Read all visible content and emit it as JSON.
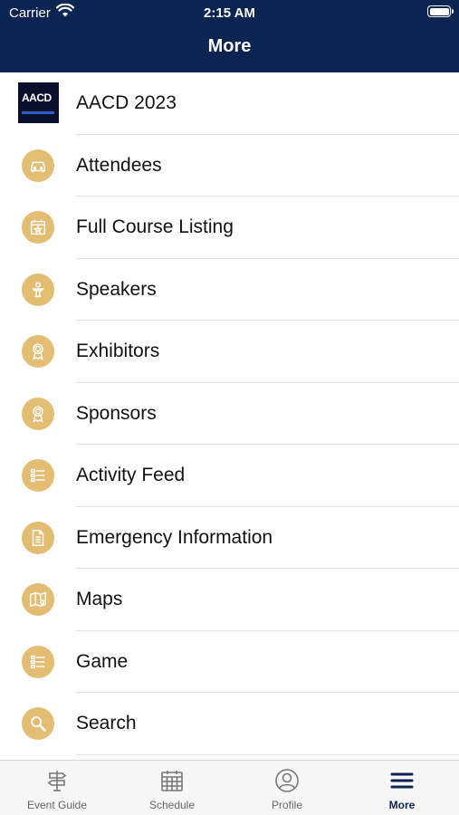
{
  "status_bar": {
    "carrier": "Carrier",
    "time": "2:15 AM"
  },
  "header": {
    "title": "More"
  },
  "menu": [
    {
      "label": "AACD 2023",
      "icon": "aacd-logo",
      "logo_text": "AACD"
    },
    {
      "label": "Attendees",
      "icon": "car-icon"
    },
    {
      "label": "Full Course Listing",
      "icon": "calendar-star-icon"
    },
    {
      "label": "Speakers",
      "icon": "podium-icon"
    },
    {
      "label": "Exhibitors",
      "icon": "ribbon-icon"
    },
    {
      "label": "Sponsors",
      "icon": "ribbon-icon"
    },
    {
      "label": "Activity Feed",
      "icon": "list-icon"
    },
    {
      "label": "Emergency Information",
      "icon": "document-icon"
    },
    {
      "label": "Maps",
      "icon": "map-pin-icon"
    },
    {
      "label": "Game",
      "icon": "list-icon"
    },
    {
      "label": "Search",
      "icon": "search-icon"
    }
  ],
  "tabbar": [
    {
      "label": "Event Guide",
      "icon": "signpost-icon"
    },
    {
      "label": "Schedule",
      "icon": "calendar-icon"
    },
    {
      "label": "Profile",
      "icon": "profile-icon"
    },
    {
      "label": "More",
      "icon": "menu-icon",
      "active": true
    }
  ],
  "colors": {
    "header": "#0b2452",
    "icon_circle": "#e3bd72"
  }
}
